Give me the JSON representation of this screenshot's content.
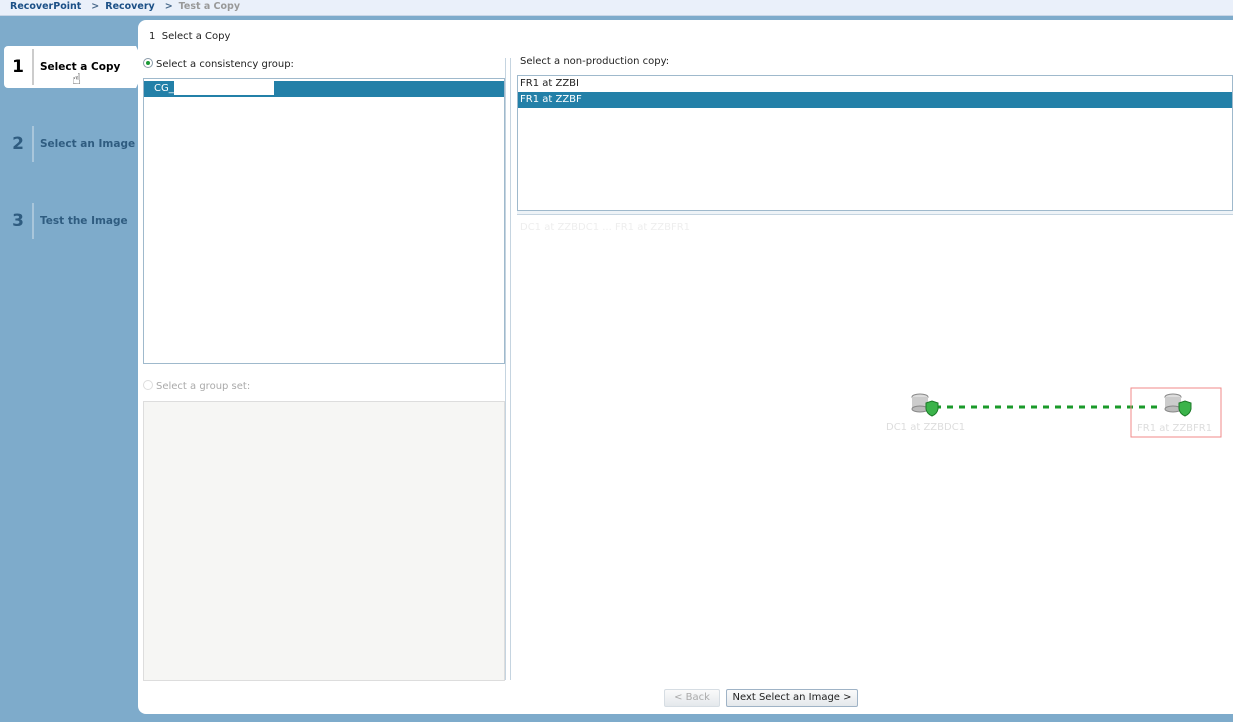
{
  "breadcrumb": [
    "RecoverPoint",
    "Recovery",
    "Test a Copy"
  ],
  "breadcrumb_sep": ">",
  "steps": [
    {
      "num": "1",
      "label": "Select a Copy"
    },
    {
      "num": "2",
      "label": "Select an Image"
    },
    {
      "num": "3",
      "label": "Test the Image"
    }
  ],
  "panel_title": "1  Select a Copy",
  "left": {
    "cg_label": "Select a consistency group:",
    "cg_items": [
      "CG_"
    ],
    "group_set_label": "Select a group set:"
  },
  "right": {
    "copy_label": "Select a non-production copy:",
    "copies": [
      "FR1 at ZZBI",
      "FR1 at ZZBF"
    ],
    "info_text": "DC1 at ZZBDC1 ... FR1 at ZZBFR1"
  },
  "diagram": {
    "nodes": [
      {
        "label": "DC1 at ZZBDC1",
        "status": "ok"
      },
      {
        "label": "FR1 at ZZBFR1",
        "status": "ok",
        "selected": true
      }
    ],
    "link_color": "#1a9a2a"
  },
  "buttons": {
    "back": "< Back",
    "next": "Next Select an Image >"
  },
  "colors": {
    "selection": "#2380a8",
    "sidebar": "#7eabcb"
  }
}
